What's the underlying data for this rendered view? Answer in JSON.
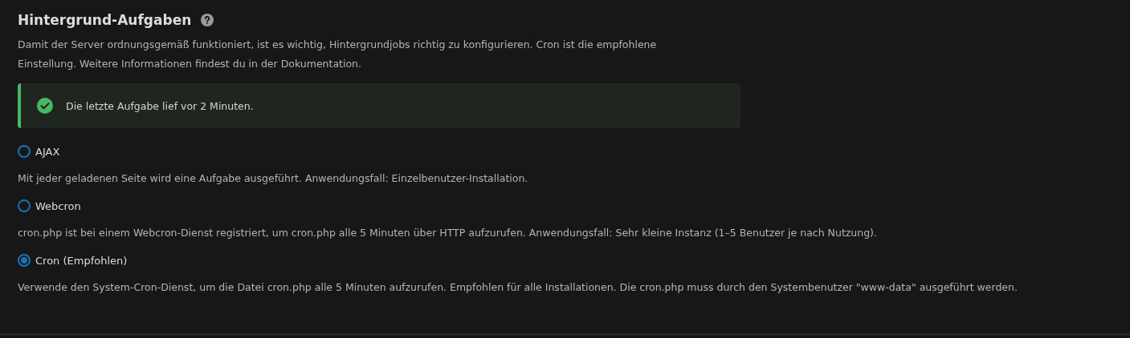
{
  "section": {
    "title": "Hintergrund-Aufgaben",
    "description": "Damit der Server ordnungsgemäß funktioniert, ist es wichtig, Hintergrundjobs richtig zu konfigurieren. Cron ist die empfohlene Einstellung. Weitere Informationen findest du in der Dokumentation."
  },
  "notice": {
    "kind": "success",
    "text": "Die letzte Aufgabe lief vor 2 Minuten."
  },
  "options": [
    {
      "label": "AJAX",
      "selected": false,
      "description": "Mit jeder geladenen Seite wird eine Aufgabe ausgeführt. Anwendungsfall: Einzelbenutzer-Installation."
    },
    {
      "label": "Webcron",
      "selected": false,
      "description": "cron.php ist bei einem Webcron-Dienst registriert, um cron.php alle 5 Minuten über HTTP aufzurufen. Anwendungsfall: Sehr kleine Instanz (1–5 Benutzer je nach Nutzung)."
    },
    {
      "label": "Cron (Empfohlen)",
      "selected": true,
      "description": "Verwende den System-Cron-Dienst, um die Datei cron.php alle 5 Minuten aufzurufen. Empfohlen für alle Installationen. Die cron.php muss durch den Systembenutzer \"www-data\" ausgeführt werden."
    }
  ]
}
